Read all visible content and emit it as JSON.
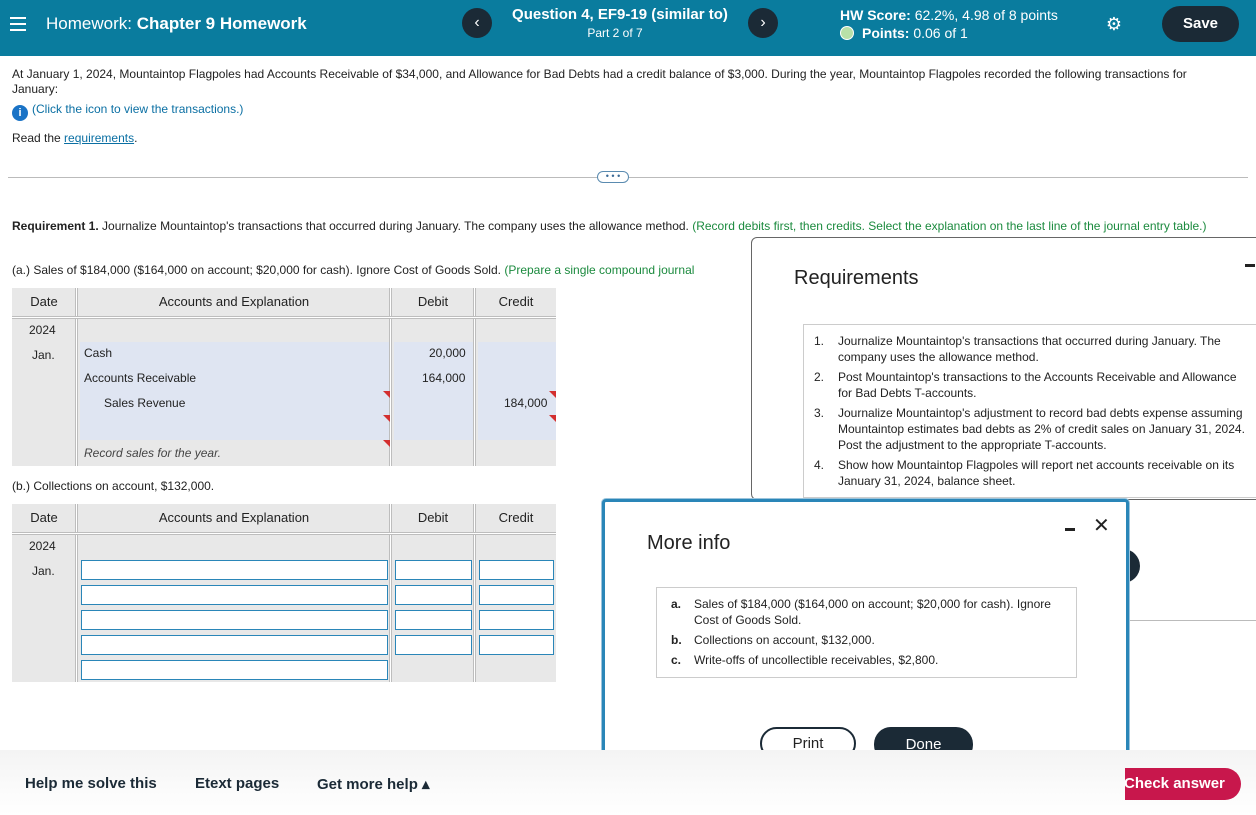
{
  "header": {
    "hw_prefix": "Homework:",
    "hw_name": "Chapter 9 Homework",
    "question_title": "Question 4, EF9-19 (similar to)",
    "question_part": "Part 2 of 7",
    "score_label": "HW Score:",
    "score_value": "62.2%, 4.98 of 8 points",
    "points_label": "Points:",
    "points_value": "0.06 of 1",
    "prev_icon": "‹",
    "next_icon": "›",
    "save_label": "Save"
  },
  "problem": {
    "intro": "At January 1, 2024, Mountaintop Flagpoles had Accounts Receivable of $34,000, and Allowance for Bad Debts had a credit balance of $3,000. During the year, Mountaintop Flagpoles recorded the following transactions for January:",
    "info_link": "(Click the icon to view the transactions.)",
    "read_prefix": "Read the",
    "read_link": "requirements",
    "read_suffix": "."
  },
  "requirement1": {
    "label": "Requirement 1.",
    "text": " Journalize Mountaintop's transactions that occurred during January. The company uses the allowance method. ",
    "hint": "(Record debits first, then credits. Select the explanation on the last line of the journal entry table.)"
  },
  "part_a": {
    "text": "(a.) Sales of $184,000 ($164,000 on account; $20,000 for cash). Ignore Cost of Goods Sold. ",
    "hint": "(Prepare a single compound journal"
  },
  "journal_headers": {
    "date": "Date",
    "accounts": "Accounts and Explanation",
    "debit": "Debit",
    "credit": "Credit"
  },
  "journal_a": {
    "year": "2024",
    "month": "Jan.",
    "rows": [
      {
        "account": "Cash",
        "debit": "20,000",
        "credit": ""
      },
      {
        "account": "Accounts Receivable",
        "debit": "164,000",
        "credit": ""
      },
      {
        "account": "Sales Revenue",
        "debit": "",
        "credit": "184,000"
      }
    ],
    "explanation": "Record sales for the year."
  },
  "part_b": {
    "text": "(b.) Collections on account, $132,000."
  },
  "journal_b": {
    "year": "2024",
    "month": "Jan."
  },
  "requirements_panel": {
    "title": "Requirements",
    "items": [
      {
        "num": "1.",
        "text": "Journalize Mountaintop's transactions that occurred during January. The company uses the allowance method."
      },
      {
        "num": "2.",
        "text": "Post Mountaintop's transactions to the Accounts Receivable and Allowance for Bad Debts T-accounts."
      },
      {
        "num": "3.",
        "text": "Journalize Mountaintop's adjustment to record bad debts expense assuming Mountaintop estimates bad debts as 2% of credit sales on January 31, 2024. Post the adjustment to the appropriate T-accounts."
      },
      {
        "num": "4.",
        "text": "Show how Mountaintop Flagpoles will report net accounts receivable on its January 31, 2024, balance sheet."
      }
    ]
  },
  "more_info": {
    "title": "More info",
    "close_icon": "✕",
    "items": [
      {
        "letter": "a.",
        "text": "Sales of $184,000 ($164,000 on account; $20,000 for cash). Ignore Cost of Goods Sold."
      },
      {
        "letter": "b.",
        "text": "Collections on account, $132,000."
      },
      {
        "letter": "c.",
        "text": "Write-offs of uncollectible receivables, $2,800."
      }
    ],
    "print_label": "Print",
    "done_label": "Done"
  },
  "footer": {
    "help_solve": "Help me solve this",
    "etext": "Etext pages",
    "more_help": "Get more help ▴",
    "check_answer": "Check answer"
  }
}
